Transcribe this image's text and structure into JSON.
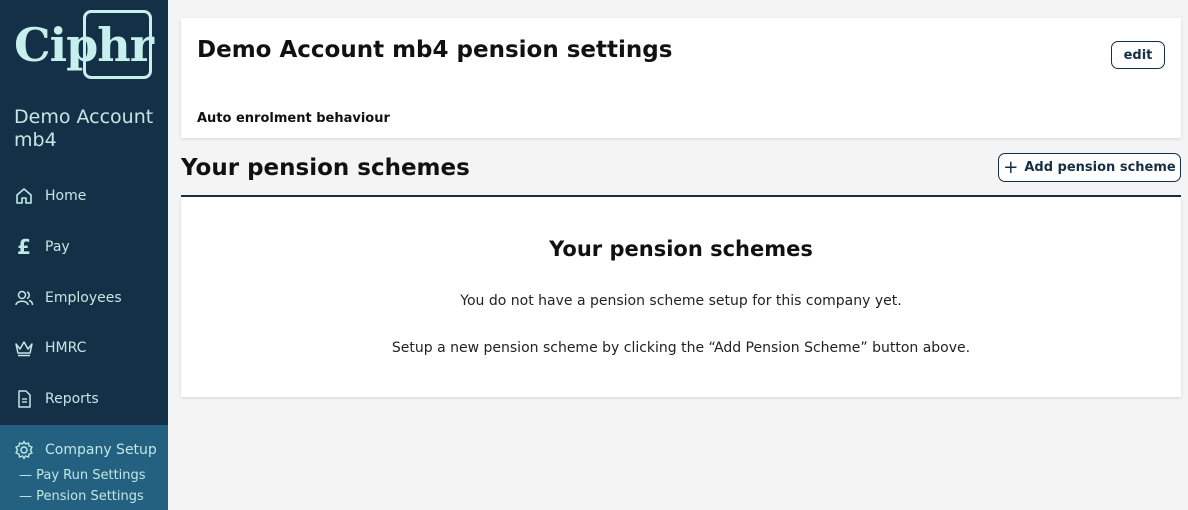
{
  "sidebar": {
    "logo": "Ciphr",
    "company_name": "Demo Account mb4",
    "nav": [
      {
        "label": "Home",
        "icon": "home-icon"
      },
      {
        "label": "Pay",
        "icon": "pound-icon"
      },
      {
        "label": "Employees",
        "icon": "people-icon"
      },
      {
        "label": "HMRC",
        "icon": "crown-icon"
      },
      {
        "label": "Reports",
        "icon": "document-icon"
      },
      {
        "label": "Company Setup",
        "icon": "gear-icon"
      }
    ],
    "sub_items": [
      "— Pay Run Settings",
      "— Pension Settings"
    ]
  },
  "settings_card": {
    "title": "Demo Account mb4 pension settings",
    "edit_label": "edit",
    "auto_enrolment_label": "Auto enrolment behaviour"
  },
  "schemes": {
    "section_title": "Your pension schemes",
    "add_label": "Add pension scheme",
    "empty_title": "Your pension schemes",
    "empty_message": "You do not have a pension scheme setup for this company yet.",
    "empty_hint": "Setup a new pension scheme by clicking the “Add Pension Scheme” button above."
  },
  "colors": {
    "sidebar_bg": "#143047",
    "sidebar_active": "#24607f",
    "accent_text": "#bfe8e6",
    "page_bg": "#f4f4f4"
  }
}
